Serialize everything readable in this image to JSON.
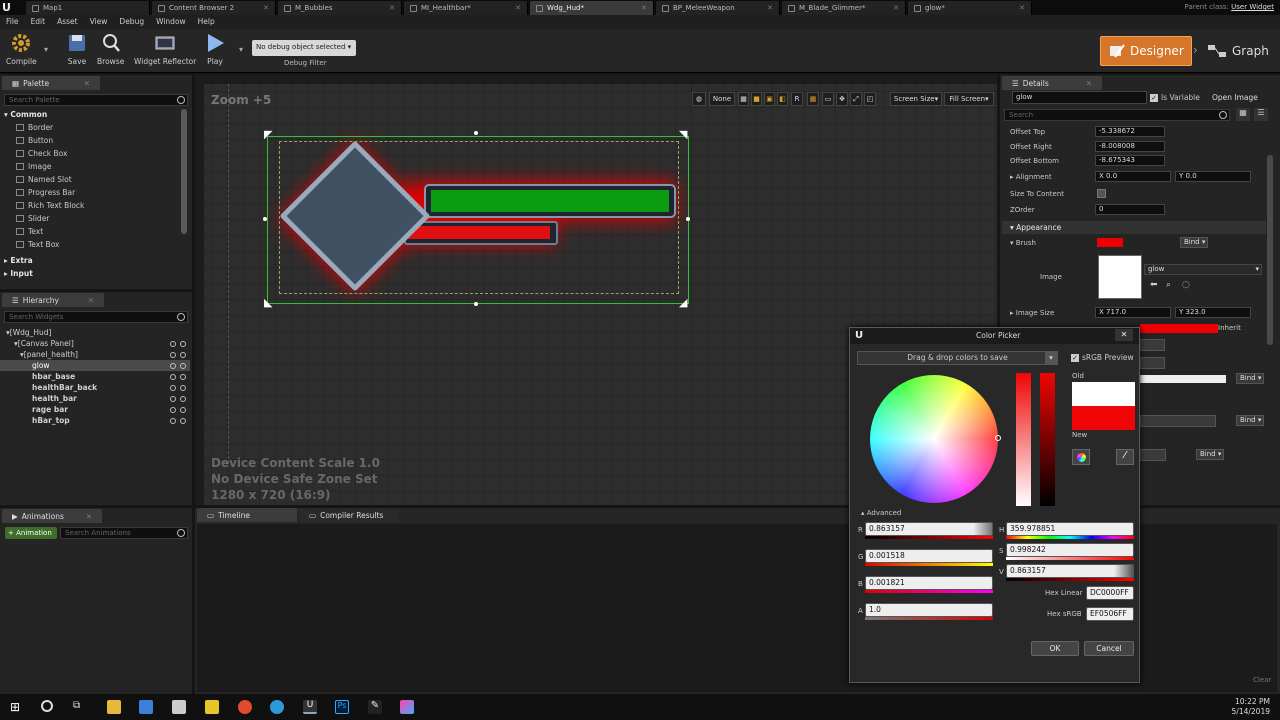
{
  "tabs": [
    {
      "label": "Map1"
    },
    {
      "label": "Content Browser 2"
    },
    {
      "label": "M_Bubbles"
    },
    {
      "label": "MI_Healthbar*"
    },
    {
      "label": "Wdg_Hud*"
    },
    {
      "label": "BP_MeleeWeapon"
    },
    {
      "label": "M_Blade_Glimmer*"
    },
    {
      "label": "glow*"
    }
  ],
  "parent_class": {
    "label": "Parent class:",
    "value": "User Widget"
  },
  "menu": [
    "File",
    "Edit",
    "Asset",
    "View",
    "Debug",
    "Window",
    "Help"
  ],
  "toolbar": {
    "compile": "Compile",
    "save": "Save",
    "browse": "Browse",
    "widget_reflector": "Widget Reflector",
    "play": "Play",
    "debug_select": "No debug object selected",
    "debug_filter": "Debug Filter",
    "designer": "Designer",
    "graph": "Graph"
  },
  "palette": {
    "title": "Palette",
    "search_placeholder": "Search Palette",
    "common": "Common",
    "items": [
      "Border",
      "Button",
      "Check Box",
      "Image",
      "Named Slot",
      "Progress Bar",
      "Rich Text Block",
      "Slider",
      "Text",
      "Text Box"
    ],
    "extra": "Extra",
    "input": "Input"
  },
  "hierarchy": {
    "title": "Hierarchy",
    "search_placeholder": "Search Widgets",
    "rows": [
      "[Wdg_Hud]",
      "[Canvas Panel]",
      "[panel_health]",
      "glow",
      "hbar_base",
      "healthBar_back",
      "health_bar",
      "rage bar",
      "hBar_top"
    ]
  },
  "animations": {
    "title": "Animations",
    "add": "+ Animation",
    "search_placeholder": "Search Animations"
  },
  "canvas": {
    "zoom": "Zoom +5",
    "none": "None",
    "r": "R",
    "screen_size": "Screen Size",
    "fill_screen": "Fill Screen",
    "device_scale": "Device Content Scale 1.0",
    "safe_zone": "No Device Safe Zone Set",
    "resolution": "1280 x 720 (16:9)"
  },
  "bottom_tabs": {
    "timeline": "Timeline",
    "compiler": "Compiler Results",
    "clear": "Clear"
  },
  "details": {
    "title": "Details",
    "name": "glow",
    "is_variable": "Is Variable",
    "open_image": "Open Image",
    "search_placeholder": "Search",
    "offset_top_label": "Offset Top",
    "offset_top": "-5.338672",
    "offset_right_label": "Offset Right",
    "offset_right": "-8.008008",
    "offset_bottom_label": "Offset Bottom",
    "offset_bottom": "-8.675343",
    "alignment_label": "Alignment",
    "align_x": "0.0",
    "align_y": "0.0",
    "size_to_content_label": "Size To Content",
    "zorder_label": "ZOrder",
    "zorder": "0",
    "appearance": "Appearance",
    "brush_label": "Brush",
    "bind": "Bind",
    "image_label": "Image",
    "image_name": "glow",
    "image_size_label": "Image Size",
    "image_size_x": "717.0",
    "image_size_y": "323.0",
    "inherit": "Inherit",
    "x": "X",
    "y": "Y"
  },
  "color_picker": {
    "title": "Color Picker",
    "drag_drop": "Drag & drop colors to save",
    "srgb_preview": "sRGB Preview",
    "old": "Old",
    "new": "New",
    "advanced": "Advanced",
    "r_label": "R",
    "r": "0.863157",
    "g_label": "G",
    "g": "0.001518",
    "b_label": "B",
    "b": "0.001821",
    "a_label": "A",
    "a": "1.0",
    "h_label": "H",
    "h": "359.978851",
    "s_label": "S",
    "s": "0.998242",
    "v_label": "V",
    "v": "0.863157",
    "hex_linear_label": "Hex Linear",
    "hex_linear": "DC0000FF",
    "hex_srgb_label": "Hex sRGB",
    "hex_srgb": "EF0506FF",
    "ok": "OK",
    "cancel": "Cancel",
    "old_color": "#ffffff",
    "new_color": "#ef0506"
  },
  "taskbar": {
    "time": "10:22 PM",
    "date": "5/14/2019"
  },
  "colors": {
    "accent": "#d5762a",
    "selection": "#2d7a2d",
    "health": "#11a417",
    "rage": "#e01010"
  }
}
